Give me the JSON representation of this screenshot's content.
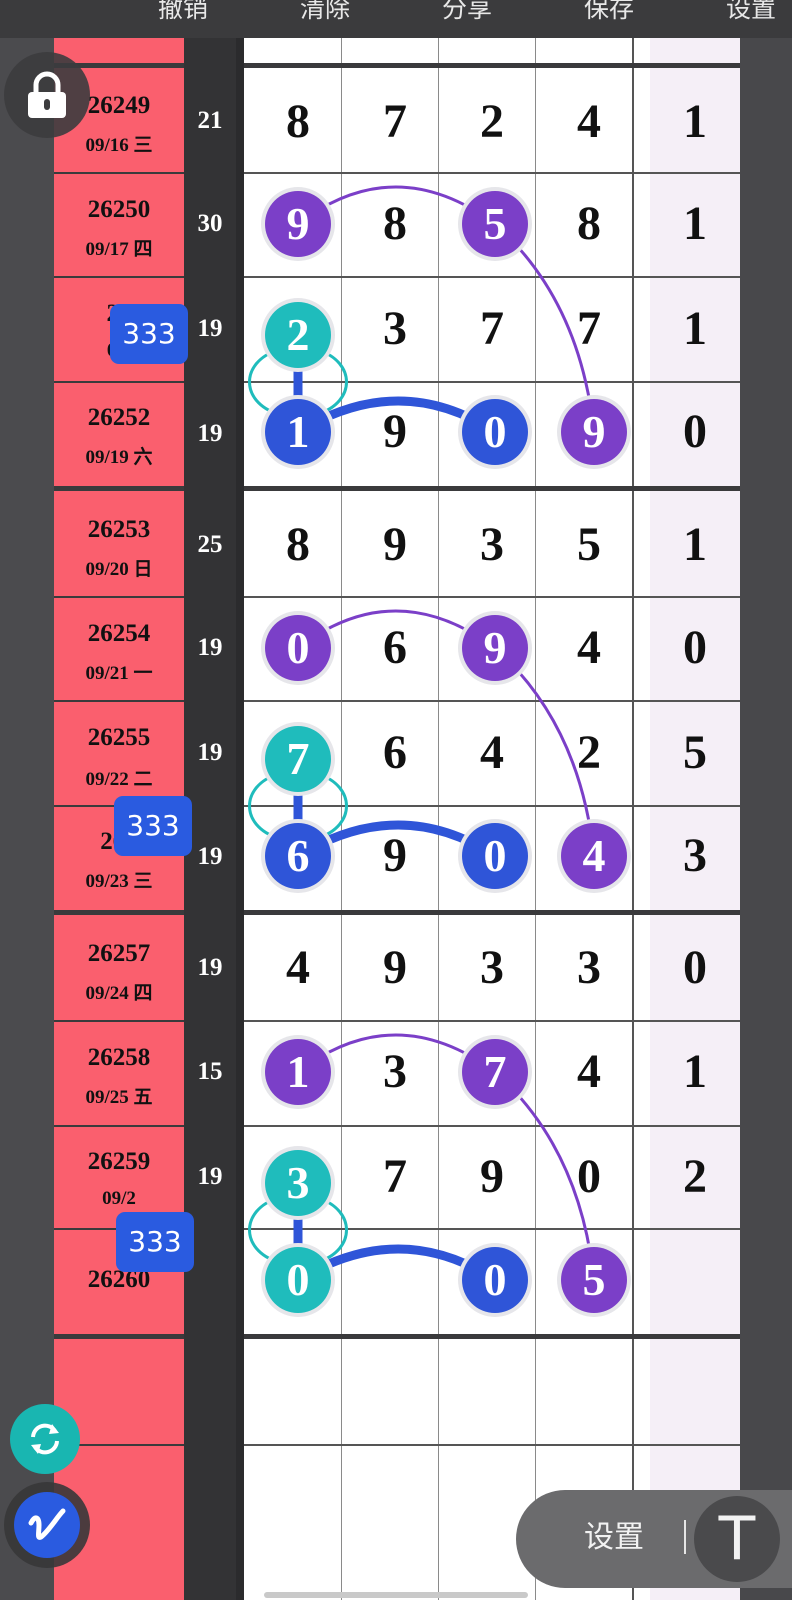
{
  "toolbar": {
    "undo": "撤销",
    "clear": "清除",
    "share": "分享",
    "save": "保存",
    "settings": "设置"
  },
  "rows": [
    {
      "period": "26249",
      "date": "09/16 三",
      "sum": "21",
      "digits": [
        "8",
        "7",
        "2",
        "4"
      ],
      "last": "1"
    },
    {
      "period": "26250",
      "date": "09/17 四",
      "sum": "30",
      "digits": [
        "9",
        "8",
        "5",
        "8"
      ],
      "last": "1"
    },
    {
      "period": "26",
      "date": "09/",
      "sum": "19",
      "digits": [
        "2",
        "3",
        "7",
        "7"
      ],
      "last": "1"
    },
    {
      "period": "26252",
      "date": "09/19 六",
      "sum": "19",
      "digits": [
        "1",
        "9",
        "0",
        "9"
      ],
      "last": "0"
    },
    {
      "period": "26253",
      "date": "09/20 日",
      "sum": "25",
      "digits": [
        "8",
        "9",
        "3",
        "5"
      ],
      "last": "1"
    },
    {
      "period": "26254",
      "date": "09/21 一",
      "sum": "19",
      "digits": [
        "0",
        "6",
        "9",
        "4"
      ],
      "last": "0"
    },
    {
      "period": "26255",
      "date": "09/22 二",
      "sum": "19",
      "digits": [
        "7",
        "6",
        "4",
        "2"
      ],
      "last": "5"
    },
    {
      "period": "262",
      "date": "09/23 三",
      "sum": "19",
      "digits": [
        "6",
        "9",
        "0",
        "4"
      ],
      "last": "3"
    },
    {
      "period": "26257",
      "date": "09/24 四",
      "sum": "19",
      "digits": [
        "4",
        "9",
        "3",
        "3"
      ],
      "last": "0"
    },
    {
      "period": "26258",
      "date": "09/25 五",
      "sum": "15",
      "digits": [
        "1",
        "3",
        "7",
        "4"
      ],
      "last": "1"
    },
    {
      "period": "26259",
      "date": "09/2",
      "sum": "19",
      "digits": [
        "3",
        "7",
        "9",
        "0"
      ],
      "last": "2"
    },
    {
      "period": "26260",
      "date": "",
      "sum": "",
      "digits": [
        "0",
        "",
        "0",
        "5"
      ],
      "last": ""
    }
  ],
  "badges": {
    "b1": "333",
    "b2": "333",
    "b3": "333"
  },
  "settings_pill": {
    "label": "设置",
    "text_tool_glyph": "T"
  },
  "icons": {
    "lock": "lock-icon",
    "refresh": "refresh-icon",
    "pen": "pen-icon",
    "text": "text-tool-icon"
  },
  "colors": {
    "purple": "#7b3fc8",
    "teal": "#1fbcbc",
    "blue": "#2f55d8",
    "red_column": "#fa5f6e",
    "lavender_column": "#f5eff7"
  }
}
